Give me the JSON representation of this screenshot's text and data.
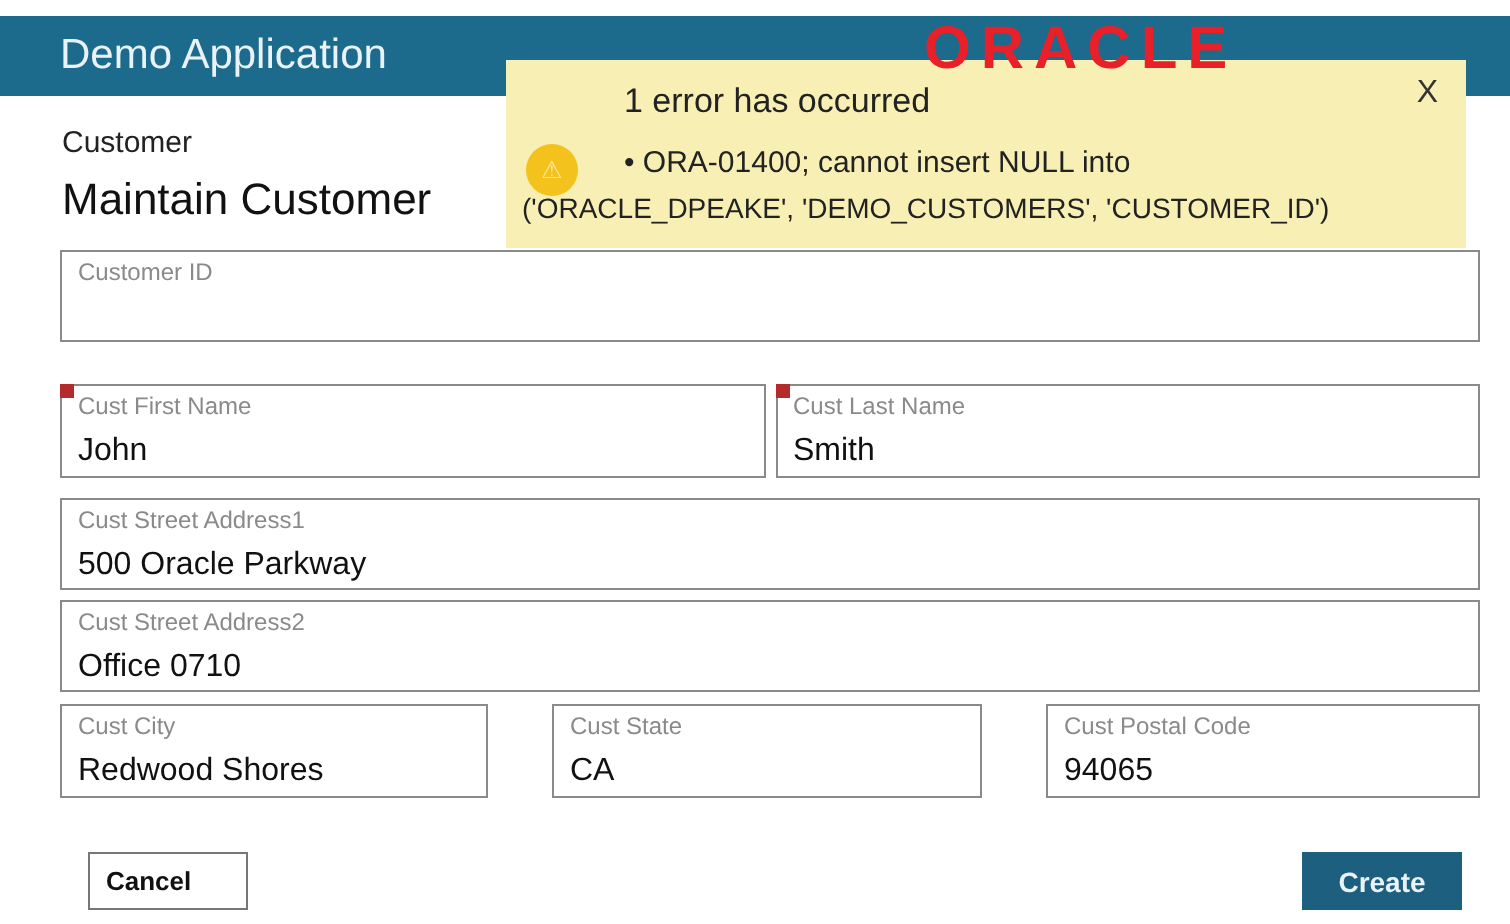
{
  "header": {
    "title": "Demo Application"
  },
  "logo": "ORACLE",
  "error": {
    "title": "1 error has occurred",
    "message": "• ORA-01400; cannot insert NULL into",
    "detail": "('ORACLE_DPEAKE', 'DEMO_CUSTOMERS', 'CUSTOMER_ID')",
    "close": "X",
    "warning_glyph": "⚠"
  },
  "breadcrumb": "Customer",
  "page_title": "Maintain Customer",
  "rows": [
    [
      {
        "label": "Customer ID",
        "required": false
      }
    ],
    [
      {
        "label": "Cust First Name",
        "value": "John",
        "required": true
      },
      {
        "label": "Cust Last Name",
        "value": "Smith",
        "required": true
      }
    ],
    [
      {
        "label": "Cust Street Address1",
        "value": "500 Oracle Parkway",
        "required": false
      }
    ],
    [
      {
        "label": "Cust Street Address2",
        "value": "Office 0710",
        "required": false
      }
    ],
    [
      {
        "label": "Cust City",
        "value": "Redwood Shores",
        "required": false
      },
      {
        "label": "Cust State",
        "value": "CA",
        "required": false
      },
      {
        "label": "Cust Postal Code",
        "value": "94065",
        "required": false
      }
    ]
  ],
  "buttons": {
    "cancel": "Cancel",
    "create": "Create"
  }
}
